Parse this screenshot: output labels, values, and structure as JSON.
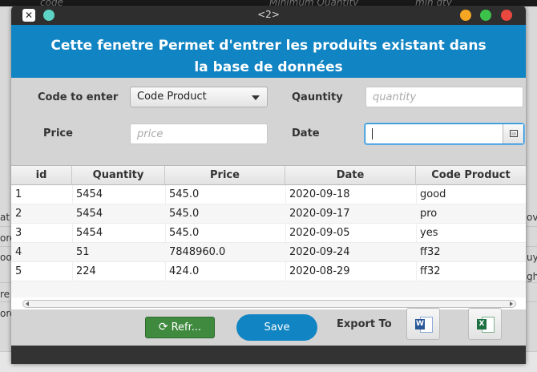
{
  "background_app": {
    "headers": [
      "code",
      "Minimum Quantity",
      "min qty"
    ],
    "row_fragments": [
      "at",
      "ore",
      "oo",
      "ore",
      "re",
      "ov",
      "uy",
      "gh"
    ]
  },
  "window": {
    "title": "<2>",
    "banner_line1": "Cette fenetre Permet d'entrer les produits existant dans",
    "banner_line2": "la base de données"
  },
  "form": {
    "code_label": "Code to enter",
    "code_value": "Code Product",
    "quantity_label": "Qauntity",
    "quantity_placeholder": "quantity",
    "price_label": "Price",
    "price_placeholder": "price",
    "date_label": "Date",
    "date_value": ""
  },
  "table": {
    "columns": [
      "id",
      "Quantity",
      "Price",
      "Date",
      "Code Product"
    ],
    "rows": [
      [
        "1",
        "5454",
        "545.0",
        "2020-09-18",
        "good"
      ],
      [
        "2",
        "5454",
        "545.0",
        "2020-09-17",
        "pro"
      ],
      [
        "3",
        "5454",
        "545.0",
        "2020-09-05",
        "yes"
      ],
      [
        "4",
        "51",
        "7848960.0",
        "2020-09-24",
        "ff32"
      ],
      [
        "5",
        "224",
        "424.0",
        "2020-08-29",
        "ff32"
      ]
    ]
  },
  "actions": {
    "refresh_label": "Refr...",
    "save_label": "Save",
    "export_label": "Export To",
    "word_icon_letter": "W",
    "excel_icon_letter": "X"
  },
  "colors": {
    "accent": "#1184c3",
    "refresh": "#3f8a3f"
  }
}
